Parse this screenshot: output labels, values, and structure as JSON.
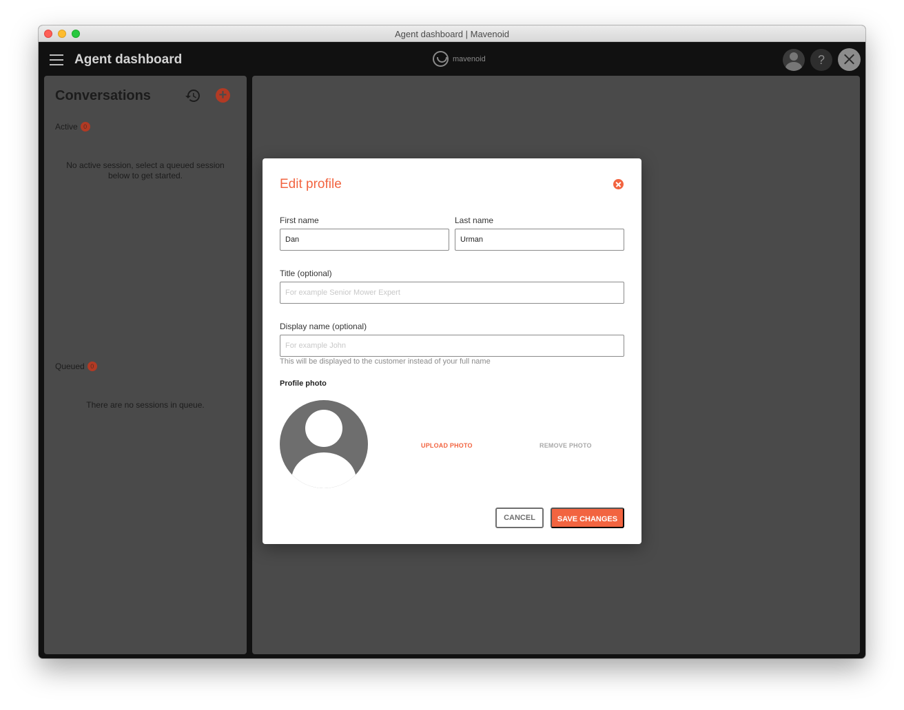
{
  "window": {
    "title": "Agent dashboard | Mavenoid"
  },
  "appbar": {
    "title": "Agent dashboard",
    "brand": "mavenoid",
    "help_label": "?"
  },
  "conversations": {
    "title": "Conversations",
    "active_label": "Active",
    "active_count": "0",
    "active_empty": "No active session, select a queued session below to get started.",
    "queued_label": "Queued",
    "queued_count": "0",
    "queued_empty": "There are no sessions in queue.",
    "add_label": "+"
  },
  "edit_profile": {
    "title": "Edit profile",
    "first_name_label": "First name",
    "first_name_value": "Dan",
    "last_name_label": "Last name",
    "last_name_value": "Urman",
    "title_label": "Title (optional)",
    "title_placeholder": "For example Senior Mower Expert",
    "display_name_label": "Display name (optional)",
    "display_name_placeholder": "For example John",
    "display_name_helper": "This will be displayed to the customer instead of your full name",
    "photo_label": "Profile photo",
    "upload_label": "UPLOAD PHOTO",
    "remove_label": "REMOVE PHOTO",
    "cancel_label": "CANCEL",
    "save_label": "SAVE CHANGES"
  },
  "colors": {
    "accent": "#f26440",
    "badge": "#b23a24",
    "panel": "#4a4a4a",
    "appbar": "#111111"
  },
  "icons": {
    "menu": "hamburger-icon",
    "history": "history-icon",
    "add": "add-circle-icon",
    "close": "close-icon",
    "help": "help-icon",
    "avatar": "user-avatar-icon"
  }
}
